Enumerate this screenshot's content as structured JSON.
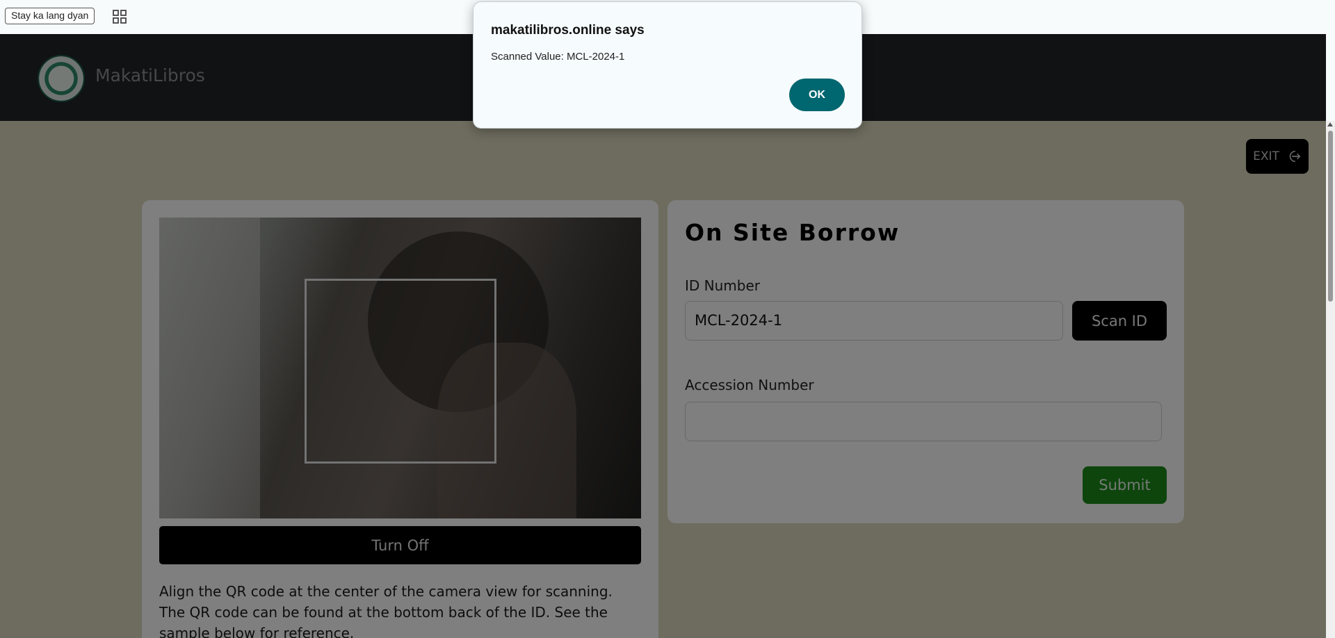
{
  "browser": {
    "bookmark_label": "Stay ka lang dyan",
    "apps_icon": "apps-grid-icon"
  },
  "navbar": {
    "brand": "MakatiLibros",
    "logo_icon": "school-seal-logo"
  },
  "exit_button": {
    "label": "EXIT",
    "icon": "exit-arrow-icon"
  },
  "camera_panel": {
    "turn_off_label": "Turn Off",
    "help_text": "Align the QR code at the center of the camera view for scanning. The QR code can be found at the bottom back of the ID. See the sample below for reference."
  },
  "form": {
    "title": "On Site Borrow",
    "id_label": "ID Number",
    "id_value": "MCL-2024-1",
    "scan_label": "Scan ID",
    "accession_label": "Accession Number",
    "accession_value": "",
    "submit_label": "Submit"
  },
  "dialog": {
    "title": "makatilibros.online says",
    "message": "Scanned Value: MCL-2024-1",
    "ok_label": "OK"
  },
  "colors": {
    "navbar": "#212529",
    "page_bg": "#dcd9bc",
    "submit": "#1a8a1a",
    "ok_button": "#00666f"
  }
}
